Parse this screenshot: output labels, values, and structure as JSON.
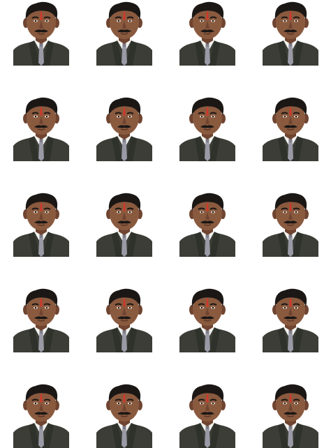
{
  "sheet": {
    "rows": 5,
    "columns": 4,
    "photo_count": 20,
    "background_color": "#ffffff",
    "subject": {
      "hair_color": "#1b1715",
      "skin_color": "#8a5a3f",
      "skin_shadow_color": "#6f4430",
      "tilak_color": "#d2372c",
      "suit_color": "#3b3d36",
      "shirt_color": "#f2f2ee",
      "tie_color": "#9a9aa6"
    }
  }
}
